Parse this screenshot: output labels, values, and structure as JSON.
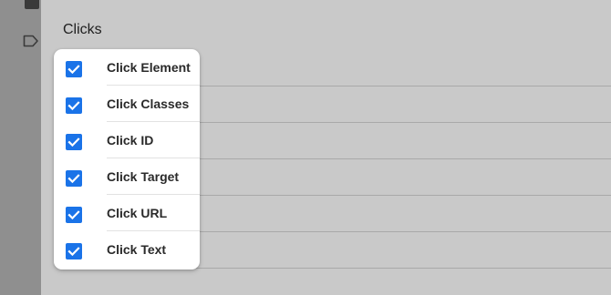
{
  "section": {
    "title": "Clicks"
  },
  "variables": [
    {
      "label": "Click Element",
      "checked": true
    },
    {
      "label": "Click Classes",
      "checked": true
    },
    {
      "label": "Click ID",
      "checked": true
    },
    {
      "label": "Click Target",
      "checked": true
    },
    {
      "label": "Click URL",
      "checked": true
    },
    {
      "label": "Click Text",
      "checked": true
    }
  ],
  "colors": {
    "checkbox": "#1a73e8",
    "overlay": "#c9c9c9",
    "rail": "#8f8f8f"
  },
  "icons": {
    "rail_top": "square-icon",
    "rail_second": "label-tag-icon",
    "checkbox": "checkmark-icon"
  }
}
